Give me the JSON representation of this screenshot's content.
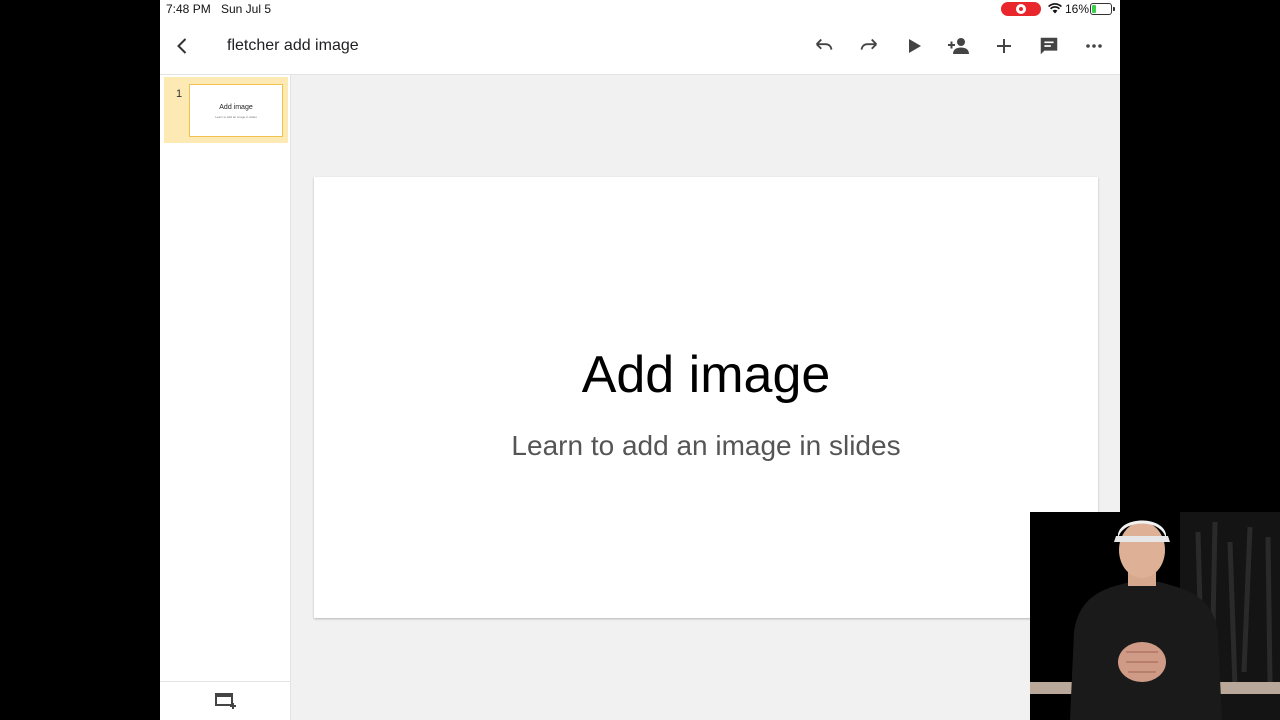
{
  "status_bar": {
    "time": "7:48 PM",
    "date": "Sun Jul 5",
    "battery_percent": "16%",
    "recording_color": "#e8262c"
  },
  "toolbar": {
    "back_icon": "chevron-left-icon",
    "document_title": "fletcher add image",
    "actions": [
      "undo-icon",
      "redo-icon",
      "present-play-icon",
      "share-add-person-icon",
      "insert-plus-icon",
      "comment-icon",
      "more-options-icon"
    ]
  },
  "filmstrip": {
    "slides": [
      {
        "number": "1",
        "title": "Add image",
        "subtitle": "Learn to add an image in slides"
      }
    ],
    "selected_color": "#fde9b3",
    "footer_icon": "new-slide-icon"
  },
  "slide": {
    "title": "Add image",
    "subtitle": "Learn to add an image in slides"
  }
}
